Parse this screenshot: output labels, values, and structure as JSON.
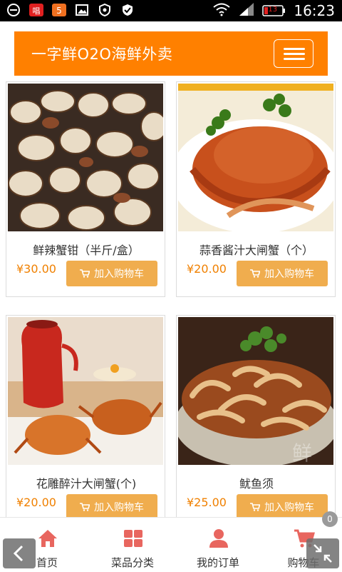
{
  "status_bar": {
    "time": "16:23",
    "battery": "13"
  },
  "header": {
    "brand": "一字鲜O2O海鲜外卖"
  },
  "products": [
    {
      "title": "鲜辣蟹钳（半斤/盒）",
      "price": "¥30.00",
      "button": "加入购物车"
    },
    {
      "title": "蒜香酱汁大闸蟹（个）",
      "price": "¥20.00",
      "button": "加入购物车"
    },
    {
      "title": "花雕醉汁大闸蟹(个)",
      "price": "¥20.00",
      "button": "加入购物车"
    },
    {
      "title": "鱿鱼须",
      "price": "¥25.00",
      "button": "加入购物车"
    }
  ],
  "bottom_nav": [
    {
      "label": "首页",
      "icon": "home-icon"
    },
    {
      "label": "菜品分类",
      "icon": "grid-icon"
    },
    {
      "label": "我的订单",
      "icon": "user-icon"
    },
    {
      "label": "购物车",
      "icon": "cart-icon"
    }
  ],
  "cart_badge": "0",
  "colors": {
    "brand_orange": "#ff8000",
    "button_orange": "#f0ad4e",
    "price_orange": "#f08000",
    "nav_icon": "#e8665f"
  }
}
